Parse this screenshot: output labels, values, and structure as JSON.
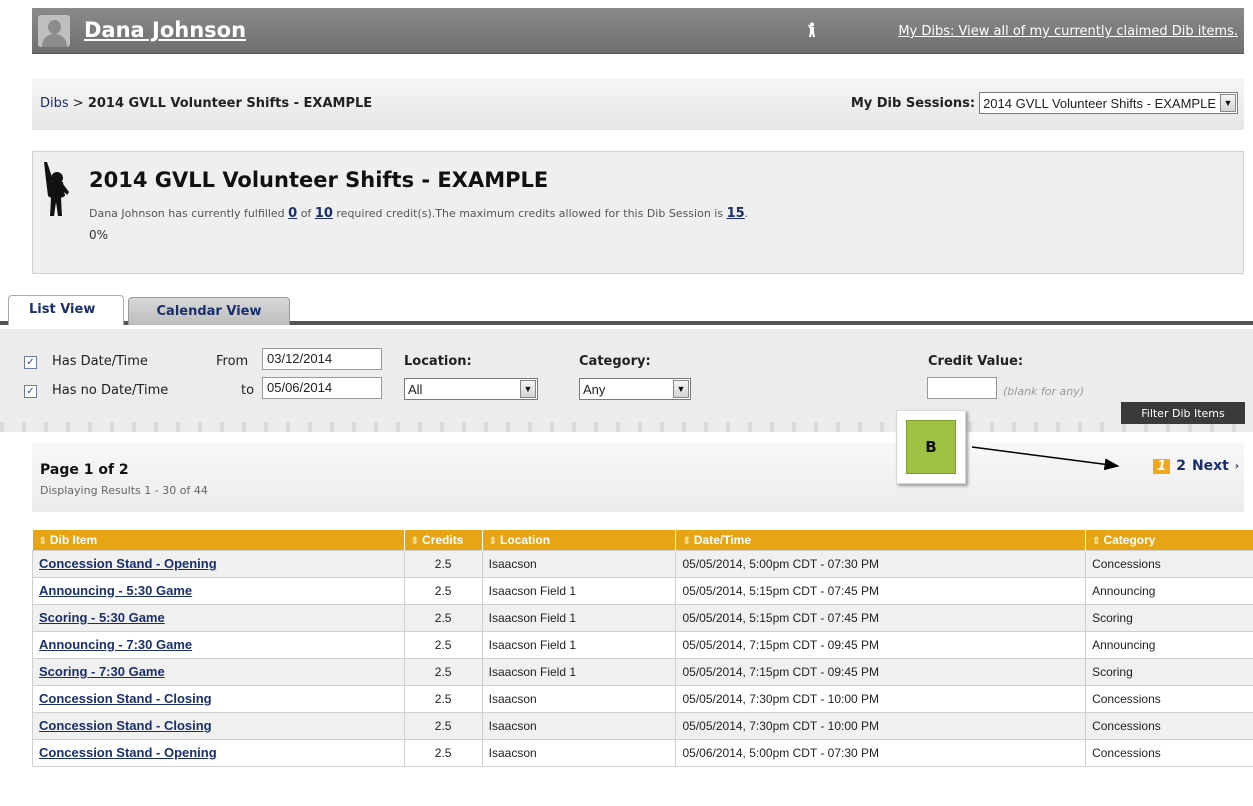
{
  "header": {
    "user_name": "Dana Johnson",
    "my_dibs_link": "My Dibs: View all of my currently claimed Dib items."
  },
  "breadcrumb": {
    "root": "Dibs",
    "separator": ">",
    "current": "2014 GVLL Volunteer Shifts - EXAMPLE"
  },
  "sessions": {
    "label": "My Dib Sessions:",
    "selected": "2014 GVLL Volunteer Shifts - EXAMPLE"
  },
  "session_panel": {
    "title": "2014 GVLL Volunteer Shifts - EXAMPLE",
    "desc_prefix": "Dana Johnson has currently fulfilled",
    "fulfilled": "0",
    "of_text": "of",
    "required": "10",
    "desc_mid": "required credit(s).The maximum credits allowed for this Dib Session is",
    "maximum": "15",
    "desc_end": ".",
    "percent": "0%"
  },
  "tabs": [
    {
      "label": "List View",
      "active": true
    },
    {
      "label": "Calendar View",
      "active": false
    }
  ],
  "filters": {
    "has_date_time": "Has Date/Time",
    "has_no_date_time": "Has no Date/Time",
    "from_label": "From",
    "from_value": "03/12/2014",
    "to_label": "to",
    "to_value": "05/06/2014",
    "location_label": "Location:",
    "location_value": "All",
    "category_label": "Category:",
    "category_value": "Any",
    "credit_label": "Credit Value:",
    "credit_value": "",
    "credit_hint": "(blank for any)",
    "filter_button": "Filter Dib Items"
  },
  "paging": {
    "title": "Page 1 of 2",
    "subtitle": "Displaying Results 1 - 30 of 44",
    "current_page": "1",
    "next_page": "2",
    "next_label": "Next",
    "next_chevron": "›"
  },
  "annotation": {
    "label": "B"
  },
  "table": {
    "columns": [
      "Dib Item",
      "Credits",
      "Location",
      "Date/Time",
      "Category"
    ],
    "sort_glyph": "⇕",
    "rows": [
      [
        "Concession Stand - Opening",
        "2.5",
        "Isaacson",
        "05/05/2014, 5:00pm CDT - 07:30 PM",
        "Concessions"
      ],
      [
        "Announcing - 5:30 Game",
        "2.5",
        "Isaacson Field 1",
        "05/05/2014, 5:15pm CDT - 07:45 PM",
        "Announcing"
      ],
      [
        "Scoring - 5:30 Game",
        "2.5",
        "Isaacson Field 1",
        "05/05/2014, 5:15pm CDT - 07:45 PM",
        "Scoring"
      ],
      [
        "Announcing - 7:30 Game",
        "2.5",
        "Isaacson Field 1",
        "05/05/2014, 7:15pm CDT - 09:45 PM",
        "Announcing"
      ],
      [
        "Scoring - 7:30 Game",
        "2.5",
        "Isaacson Field 1",
        "05/05/2014, 7:15pm CDT - 09:45 PM",
        "Scoring"
      ],
      [
        "Concession Stand - Closing",
        "2.5",
        "Isaacson",
        "05/05/2014, 7:30pm CDT - 10:00 PM",
        "Concessions"
      ],
      [
        "Concession Stand - Closing",
        "2.5",
        "Isaacson",
        "05/05/2014, 7:30pm CDT - 10:00 PM",
        "Concessions"
      ],
      [
        "Concession Stand - Opening",
        "2.5",
        "Isaacson",
        "05/06/2014, 5:00pm CDT - 07:30 PM",
        "Concessions"
      ]
    ]
  }
}
